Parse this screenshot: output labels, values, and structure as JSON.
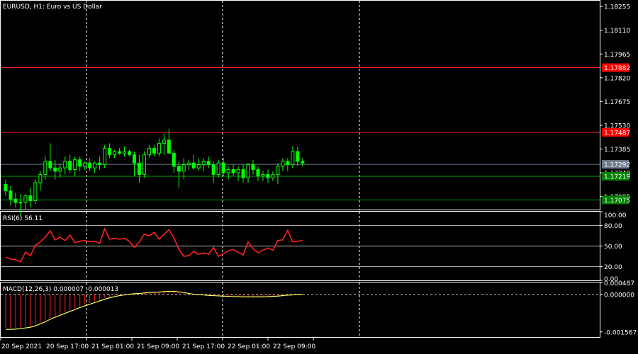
{
  "colors": {
    "background": "#000000",
    "frame": "#ffffff",
    "grid": "#ffffff",
    "bull": "#00ff00",
    "bear": "#00ff00",
    "rsi": "#ff2020",
    "macd_hist": "#ff2020",
    "macd_signal": "#ffff66",
    "level_red": "#ff2020",
    "level_green": "#00a000",
    "bid_line": "#6e7b8b",
    "tag_red_bg": "#ff0000",
    "tag_green_bg": "#008000",
    "tag_bid_bg": "#6e7b8b"
  },
  "chart_data": [
    {
      "type": "candlestick",
      "title": "EURUSD, H1:  Euro vs US Dollar",
      "symbol": "EURUSD",
      "timeframe": "H1",
      "ylim": [
        1.17016,
        1.1829
      ],
      "y_ticks": [
        "1.18255",
        "1.18110",
        "1.17965",
        "1.17820",
        "1.17675",
        "1.17530",
        "1.17385",
        "1.17240",
        "1.17095"
      ],
      "y_tick_values": [
        1.18255,
        1.1811,
        1.17965,
        1.1782,
        1.17675,
        1.1753,
        1.17385,
        1.1724,
        1.17095
      ],
      "price_levels": [
        {
          "value": 1.17882,
          "label": "1.17882",
          "kind": "red"
        },
        {
          "value": 1.17487,
          "label": "1.17487",
          "kind": "red"
        },
        {
          "value": 1.17292,
          "label": "1.17292",
          "kind": "bid"
        },
        {
          "value": 1.17219,
          "label": "1.17219",
          "kind": "green"
        },
        {
          "value": 1.17075,
          "label": "1.17075",
          "kind": "green"
        }
      ],
      "x_ticks": [
        "20 Sep 2021",
        "20 Sep 17:00",
        "21 Sep 01:00",
        "21 Sep 09:00",
        "21 Sep 17:00",
        "22 Sep 01:00",
        "22 Sep 09:00"
      ],
      "candles": [
        {
          "o": 1.1717,
          "h": 1.172,
          "l": 1.171,
          "c": 1.1713
        },
        {
          "o": 1.1713,
          "h": 1.1716,
          "l": 1.1704,
          "c": 1.1708
        },
        {
          "o": 1.1708,
          "h": 1.1712,
          "l": 1.1703,
          "c": 1.1706
        },
        {
          "o": 1.1706,
          "h": 1.1711,
          "l": 1.1698,
          "c": 1.1706
        },
        {
          "o": 1.1706,
          "h": 1.1711,
          "l": 1.1702,
          "c": 1.171
        },
        {
          "o": 1.171,
          "h": 1.1715,
          "l": 1.1703,
          "c": 1.1707
        },
        {
          "o": 1.1707,
          "h": 1.172,
          "l": 1.1705,
          "c": 1.1718
        },
        {
          "o": 1.1718,
          "h": 1.1725,
          "l": 1.1713,
          "c": 1.1723
        },
        {
          "o": 1.1723,
          "h": 1.1734,
          "l": 1.172,
          "c": 1.1731
        },
        {
          "o": 1.1731,
          "h": 1.1742,
          "l": 1.1725,
          "c": 1.1727
        },
        {
          "o": 1.1727,
          "h": 1.1732,
          "l": 1.172,
          "c": 1.1725
        },
        {
          "o": 1.1725,
          "h": 1.173,
          "l": 1.1721,
          "c": 1.1727
        },
        {
          "o": 1.1727,
          "h": 1.1734,
          "l": 1.1723,
          "c": 1.1731
        },
        {
          "o": 1.1731,
          "h": 1.1735,
          "l": 1.1724,
          "c": 1.1726
        },
        {
          "o": 1.1726,
          "h": 1.1734,
          "l": 1.1722,
          "c": 1.1732
        },
        {
          "o": 1.1732,
          "h": 1.1734,
          "l": 1.1725,
          "c": 1.1728
        },
        {
          "o": 1.1728,
          "h": 1.1731,
          "l": 1.1726,
          "c": 1.173
        },
        {
          "o": 1.173,
          "h": 1.1733,
          "l": 1.1725,
          "c": 1.1727
        },
        {
          "o": 1.1727,
          "h": 1.1731,
          "l": 1.1724,
          "c": 1.173
        },
        {
          "o": 1.173,
          "h": 1.1734,
          "l": 1.1726,
          "c": 1.1729
        },
        {
          "o": 1.1729,
          "h": 1.1741,
          "l": 1.1727,
          "c": 1.1739
        },
        {
          "o": 1.1739,
          "h": 1.1742,
          "l": 1.1733,
          "c": 1.1735
        },
        {
          "o": 1.1735,
          "h": 1.1738,
          "l": 1.1733,
          "c": 1.1737
        },
        {
          "o": 1.1737,
          "h": 1.1739,
          "l": 1.1735,
          "c": 1.1736
        },
        {
          "o": 1.1736,
          "h": 1.174,
          "l": 1.1734,
          "c": 1.1737
        },
        {
          "o": 1.1737,
          "h": 1.1738,
          "l": 1.1734,
          "c": 1.1735
        },
        {
          "o": 1.1735,
          "h": 1.1737,
          "l": 1.1722,
          "c": 1.173
        },
        {
          "o": 1.173,
          "h": 1.1735,
          "l": 1.1718,
          "c": 1.1723
        },
        {
          "o": 1.1723,
          "h": 1.1737,
          "l": 1.1721,
          "c": 1.1735
        },
        {
          "o": 1.1735,
          "h": 1.1741,
          "l": 1.1733,
          "c": 1.1739
        },
        {
          "o": 1.1739,
          "h": 1.1741,
          "l": 1.1734,
          "c": 1.1736
        },
        {
          "o": 1.1736,
          "h": 1.1745,
          "l": 1.1734,
          "c": 1.1742
        },
        {
          "o": 1.1742,
          "h": 1.1748,
          "l": 1.1735,
          "c": 1.1744
        },
        {
          "o": 1.1744,
          "h": 1.1751,
          "l": 1.174,
          "c": 1.1736
        },
        {
          "o": 1.1736,
          "h": 1.1738,
          "l": 1.1724,
          "c": 1.1728
        },
        {
          "o": 1.1728,
          "h": 1.1731,
          "l": 1.1715,
          "c": 1.1725
        },
        {
          "o": 1.1725,
          "h": 1.1733,
          "l": 1.172,
          "c": 1.1729
        },
        {
          "o": 1.1729,
          "h": 1.1732,
          "l": 1.1726,
          "c": 1.173
        },
        {
          "o": 1.173,
          "h": 1.1735,
          "l": 1.1726,
          "c": 1.1727
        },
        {
          "o": 1.1727,
          "h": 1.1733,
          "l": 1.1725,
          "c": 1.1729
        },
        {
          "o": 1.1729,
          "h": 1.1733,
          "l": 1.1725,
          "c": 1.1731
        },
        {
          "o": 1.1731,
          "h": 1.1734,
          "l": 1.1727,
          "c": 1.1729
        },
        {
          "o": 1.1729,
          "h": 1.1731,
          "l": 1.1718,
          "c": 1.1723
        },
        {
          "o": 1.1723,
          "h": 1.1732,
          "l": 1.1721,
          "c": 1.173
        },
        {
          "o": 1.173,
          "h": 1.1733,
          "l": 1.1722,
          "c": 1.1724
        },
        {
          "o": 1.1724,
          "h": 1.1728,
          "l": 1.172,
          "c": 1.1726
        },
        {
          "o": 1.1726,
          "h": 1.1729,
          "l": 1.1722,
          "c": 1.1724
        },
        {
          "o": 1.1724,
          "h": 1.1728,
          "l": 1.1719,
          "c": 1.1726
        },
        {
          "o": 1.1726,
          "h": 1.1729,
          "l": 1.1718,
          "c": 1.1721
        },
        {
          "o": 1.1721,
          "h": 1.173,
          "l": 1.1718,
          "c": 1.1729
        },
        {
          "o": 1.1729,
          "h": 1.1732,
          "l": 1.1723,
          "c": 1.1726
        },
        {
          "o": 1.1726,
          "h": 1.1728,
          "l": 1.1719,
          "c": 1.1722
        },
        {
          "o": 1.1722,
          "h": 1.1725,
          "l": 1.1719,
          "c": 1.1723
        },
        {
          "o": 1.1723,
          "h": 1.1726,
          "l": 1.1718,
          "c": 1.1721
        },
        {
          "o": 1.1721,
          "h": 1.1725,
          "l": 1.1719,
          "c": 1.1723
        },
        {
          "o": 1.1723,
          "h": 1.173,
          "l": 1.1717,
          "c": 1.1728
        },
        {
          "o": 1.1728,
          "h": 1.1733,
          "l": 1.1725,
          "c": 1.1731
        },
        {
          "o": 1.1731,
          "h": 1.1733,
          "l": 1.1725,
          "c": 1.1729
        },
        {
          "o": 1.1729,
          "h": 1.174,
          "l": 1.1727,
          "c": 1.1737
        },
        {
          "o": 1.1737,
          "h": 1.174,
          "l": 1.1728,
          "c": 1.1731
        },
        {
          "o": 1.1731,
          "h": 1.1733,
          "l": 1.1728,
          "c": 1.173
        }
      ]
    },
    {
      "type": "line",
      "title": "RSI(6) 56.11",
      "ylim": [
        0,
        100
      ],
      "y_ticks": [
        "100.00",
        "80.00",
        "50.00",
        "20.00",
        "0.00"
      ],
      "y_tick_values": [
        100,
        80,
        50,
        20,
        0
      ],
      "levels": [
        80,
        50,
        20
      ],
      "series": [
        {
          "values": [
            34,
            31,
            30,
            27,
            41,
            36,
            51,
            56,
            63,
            72,
            59,
            63,
            58,
            66,
            55,
            57,
            58,
            56,
            57,
            54,
            75,
            60,
            61,
            60,
            61,
            57,
            48,
            56,
            67,
            65,
            70,
            60,
            67,
            74,
            62,
            45,
            35,
            36,
            42,
            38,
            40,
            38,
            48,
            35,
            39,
            43,
            45,
            41,
            37,
            56,
            46,
            40,
            44,
            47,
            44,
            58,
            59,
            73,
            56,
            57,
            58
          ]
        }
      ]
    },
    {
      "type": "bar+line",
      "title": "MACD(12,26,3) 0.000007 -0.000013",
      "ylim": [
        -0.00178,
        0.0005
      ],
      "y_ticks": [
        "0.000487",
        "0.000000",
        "-0.001567"
      ],
      "y_tick_values": [
        0.000487,
        0.0,
        -0.001567
      ],
      "histogram": [
        -0.0014,
        -0.0014,
        -0.00139,
        -0.00138,
        -0.00135,
        -0.00132,
        -0.00126,
        -0.00118,
        -0.00108,
        -0.00098,
        -0.0009,
        -0.00083,
        -0.00074,
        -0.00066,
        -0.00058,
        -0.0005,
        -0.00043,
        -0.00036,
        -0.00029,
        -0.00022,
        -0.00014,
        -9e-05,
        -4e-05,
        -1e-05,
        1e-05,
        3e-05,
        5e-05,
        6e-05,
        8e-05,
        0.0001,
        0.00011,
        0.00012,
        0.00014,
        0.00016,
        0.00015,
        0.00011,
        7e-05,
        3e-05,
        0.0,
        -2e-05,
        -3e-05,
        -5e-05,
        -6e-05,
        -7e-05,
        -8e-05,
        -9e-05,
        -0.0001,
        -0.0001,
        -0.00011,
        -0.0001,
        -0.00011,
        -0.00011,
        -0.00011,
        -0.0001,
        -9e-05,
        -7e-05,
        -5e-05,
        -3e-05,
        -1e-05,
        1e-05,
        1e-05
      ],
      "signal": [
        -0.00146,
        -0.00146,
        -0.00145,
        -0.00143,
        -0.0014,
        -0.00137,
        -0.00131,
        -0.00123,
        -0.00114,
        -0.00104,
        -0.00095,
        -0.00087,
        -0.00079,
        -0.00071,
        -0.00063,
        -0.00055,
        -0.00048,
        -0.00041,
        -0.00034,
        -0.00027,
        -0.0002,
        -0.00014,
        -9e-05,
        -5e-05,
        -2e-05,
        1e-05,
        3e-05,
        4e-05,
        6e-05,
        8e-05,
        9e-05,
        0.0001,
        0.00012,
        0.00013,
        0.00013,
        0.00011,
        8e-05,
        4e-05,
        1e-05,
        -1e-05,
        -2e-05,
        -4e-05,
        -5e-05,
        -6e-05,
        -7e-05,
        -8e-05,
        -9e-05,
        -9e-05,
        -0.0001,
        -0.0001,
        -0.0001,
        -0.0001,
        -0.0001,
        -9e-05,
        -8e-05,
        -7e-05,
        -5e-05,
        -3e-05,
        -2e-05,
        0.0,
        1e-05
      ]
    }
  ]
}
